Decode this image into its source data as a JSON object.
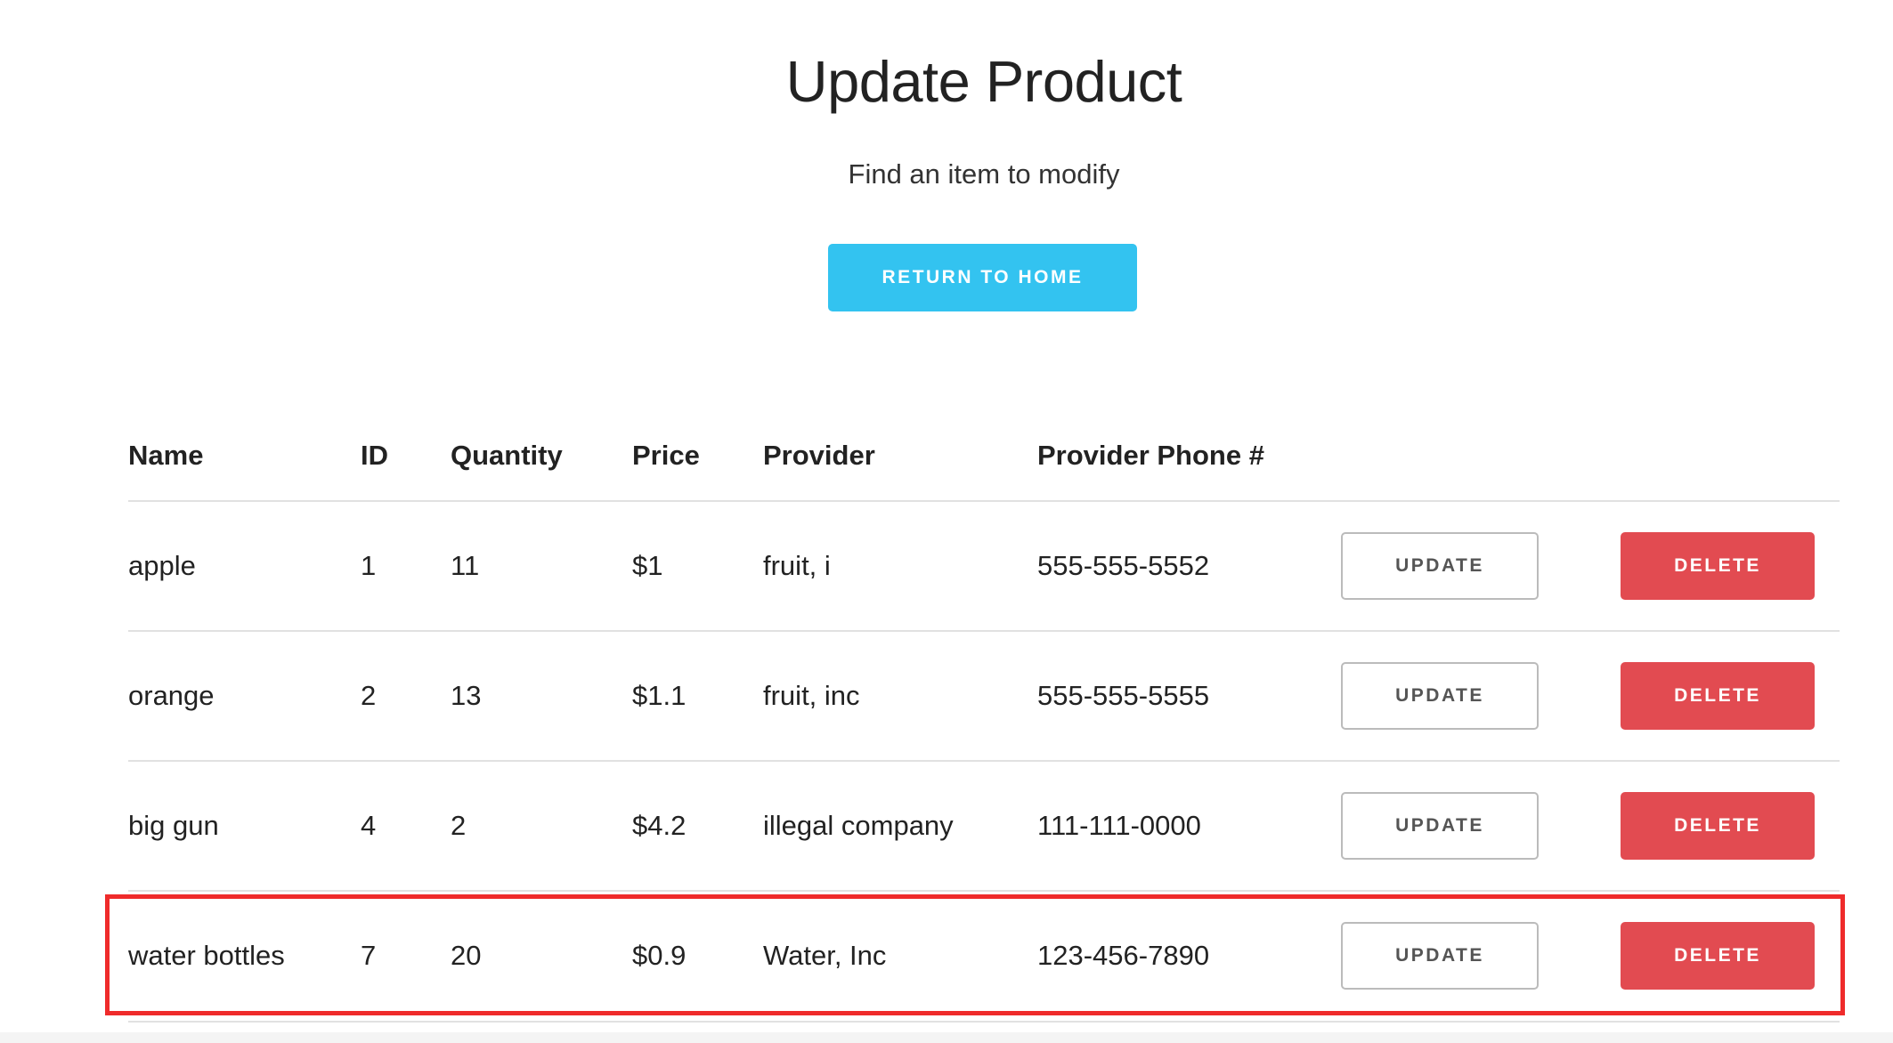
{
  "page": {
    "title": "Update Product",
    "subtitle": "Find an item to modify",
    "home_button_label": "RETURN TO HOME"
  },
  "table": {
    "headers": {
      "name": "Name",
      "id": "ID",
      "quantity": "Quantity",
      "price": "Price",
      "provider": "Provider",
      "phone": "Provider Phone #"
    },
    "update_label": "UPDATE",
    "delete_label": "DELETE",
    "rows": [
      {
        "name": "apple",
        "id": "1",
        "quantity": "11",
        "price": "$1",
        "provider": "fruit, i",
        "phone": "555-555-5552"
      },
      {
        "name": "orange",
        "id": "2",
        "quantity": "13",
        "price": "$1.1",
        "provider": "fruit, inc",
        "phone": "555-555-5555"
      },
      {
        "name": "big gun",
        "id": "4",
        "quantity": "2",
        "price": "$4.2",
        "provider": "illegal company",
        "phone": "111-111-0000"
      },
      {
        "name": "water bottles",
        "id": "7",
        "quantity": "20",
        "price": "$0.9",
        "provider": "Water, Inc",
        "phone": "123-456-7890"
      }
    ]
  },
  "colors": {
    "primary_button": "#33c3f0",
    "delete_button": "#e24b51",
    "highlight_outline": "#ef2b2b"
  }
}
